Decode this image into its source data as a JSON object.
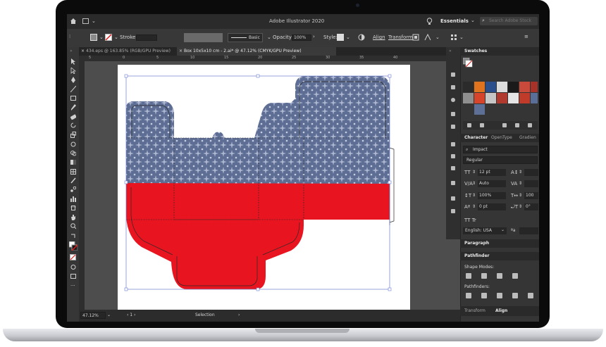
{
  "window": {
    "title": "Adobe Illustrator 2020"
  },
  "menubar": {
    "workspace": "Essentials",
    "search_placeholder": "Search Adobe Stock"
  },
  "control_bar": {
    "stroke_label": "Stroke:",
    "brush_label": "Basic",
    "opacity_label": "Opacity:",
    "opacity_value": "100%",
    "style_label": "Style:",
    "align_label": "Align",
    "transform_label": "Transform"
  },
  "tabs": [
    {
      "label": "434.eps @ 163.85% (RGB/GPU Preview)",
      "active": false
    },
    {
      "label": "Box 10x5x10 cm - 2.ai* @ 47.12% (CMYK/GPU Preview)",
      "active": true
    }
  ],
  "ruler": {
    "ticks": [
      "5",
      "0",
      "5",
      "10",
      "15",
      "20",
      "25",
      "30",
      "35",
      "40"
    ]
  },
  "status": {
    "zoom": "47.12%",
    "tool": "Selection"
  },
  "swatches_panel": {
    "title": "Swatches"
  },
  "character_panel": {
    "tabs": [
      "Character",
      "OpenType",
      "Gradien"
    ],
    "font_search": "Impact",
    "font_style": "Regular",
    "size": "12 pt",
    "leading": "Auto",
    "vscale": "100%",
    "tracking": "0 pt",
    "hscale": "100",
    "baseline": "0°",
    "tt_label": "TT  Tr",
    "language": "English: USA",
    "aa": "a"
  },
  "paragraph_panel": {
    "title": "Paragraph"
  },
  "pathfinder_panel": {
    "title": "Pathfinder",
    "shape_modes": "Shape Modes:",
    "pathfinders": "Pathfinders:"
  },
  "bottom_tabs": [
    "Transform",
    "Align"
  ],
  "colors": {
    "box_blue": "#5e6f96",
    "box_red": "#e8141f",
    "ui_dark": "#323232"
  }
}
